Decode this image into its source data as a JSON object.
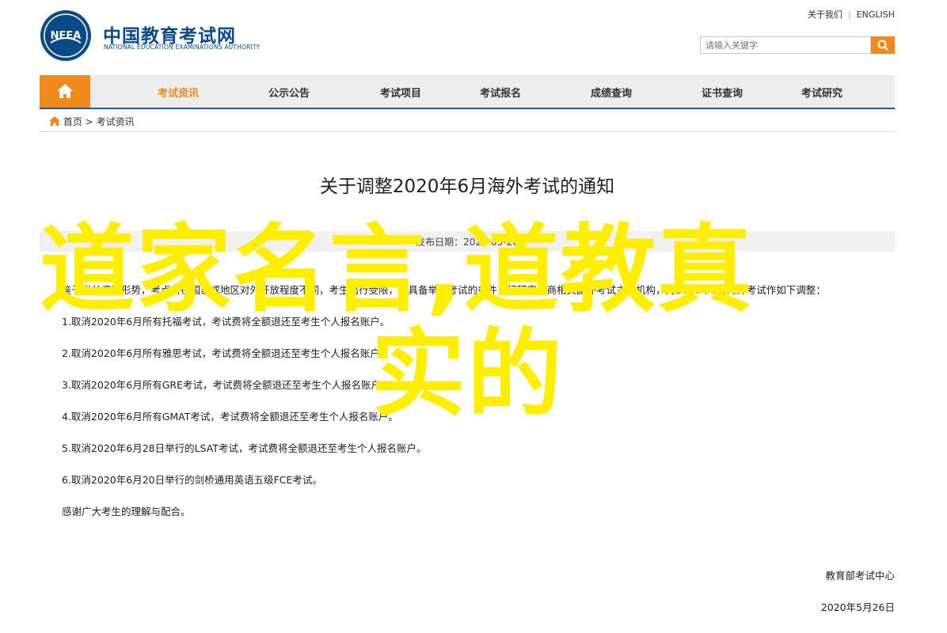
{
  "header": {
    "brand_cn": "中国教育考试网",
    "brand_en": "NATIONAL EDUCATION EXAMINATIONS AUTHORITY",
    "logo_text": "NEEA",
    "links": {
      "about": "关于我们",
      "english": "ENGLISH"
    },
    "search_placeholder": "请输入关键字"
  },
  "nav": {
    "items": [
      {
        "label": "考试资讯",
        "active": true
      },
      {
        "label": "公示公告"
      },
      {
        "label": "考试项目"
      },
      {
        "label": "考试报名"
      },
      {
        "label": "成绩查询"
      },
      {
        "label": "证书查询"
      },
      {
        "label": "考试研究"
      }
    ]
  },
  "breadcrumb": {
    "home": "首页",
    "separator": ">",
    "current": "考试资讯"
  },
  "article": {
    "title": "关于调整2020年6月海外考试的通知",
    "meta": "发布日期：2020-05-26",
    "intro": "鉴于当前疫情形势，考点所在国家或地区对外开放程度不同，考生出行受限，不具备举办考试的条件，经研究并商相关国外考试主办机构，对2020年6月海外考试作如下调整：",
    "items": [
      "1.取消2020年6月所有托福考试，考试费将全额退还至考生个人报名账户。",
      "2.取消2020年6月所有雅思考试，考试费将全额退还至考生个人报名账户。",
      "3.取消2020年6月所有GRE考试，考试费将全额退还至考生个人报名账户。",
      "4.取消2020年6月所有GMAT考试，考试费将全额退还至考生个人报名账户。",
      "5.取消2020年6月28日举行的LSAT考试，考试费将全额退还至考生个人报名账户。",
      "6.取消2020年6月20日举行的剑桥通用英语五级FCE考试。"
    ],
    "closing": "感谢广大考生的理解与配合。",
    "signature": "教育部考试中心",
    "date": "2020年5月26日"
  },
  "overlay": {
    "line1": "道家名言,道教真",
    "line2": "实的",
    "color": "#ffee00"
  },
  "colors": {
    "brand": "#0b4a8a",
    "accent": "#f08a1c",
    "nav_border": "#1f5aa6"
  }
}
